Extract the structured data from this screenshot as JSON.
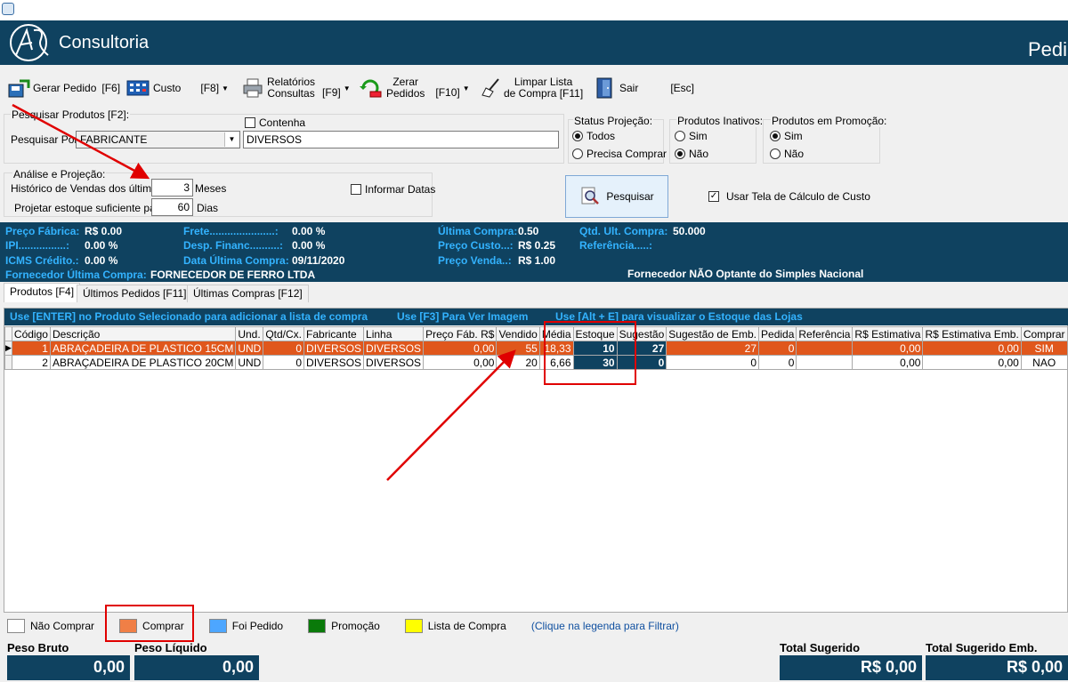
{
  "header": {
    "brand": "Consultoria",
    "title": "Pedi"
  },
  "toolbar": {
    "gerar_pedido": {
      "label": "Gerar Pedido",
      "key": "[F6]"
    },
    "custo": {
      "label": "Custo",
      "key": "[F8]"
    },
    "relatorios": {
      "label": "Relatórios\nConsultas",
      "key": "[F9]"
    },
    "zerar": {
      "label": "Zerar\nPedidos",
      "key": "[F10]"
    },
    "limpar": {
      "label": "Limpar Lista\nde Compra [F11]"
    },
    "sair": {
      "label": "Sair",
      "key": "[Esc]"
    }
  },
  "search": {
    "group_label": "Pesquisar Produtos [F2]:",
    "by_label": "Pesquisar Por:",
    "by_value": "FABRICANTE",
    "contains_label": "Contenha",
    "text_value": "DIVERSOS"
  },
  "status_projecao": {
    "label": "Status Projeção:",
    "options": [
      "Todos",
      "Precisa Comprar"
    ],
    "selected": "Todos"
  },
  "produtos_inativos": {
    "label": "Produtos Inativos:",
    "options": [
      "Sim",
      "Não"
    ],
    "selected": "Não"
  },
  "produtos_promocao": {
    "label": "Produtos em Promoção:",
    "options": [
      "Sim",
      "Não"
    ],
    "selected": "Sim"
  },
  "analise": {
    "group_label": "Análise e Projeção:",
    "historico_label": "Histórico de Vendas dos últimos",
    "historico_value": "3",
    "historico_unit": "Meses",
    "projetar_label": "Projetar estoque suficiente para",
    "projetar_value": "60",
    "projetar_unit": "Dias",
    "informar_datas": "Informar Datas"
  },
  "pesquisar_button": "Pesquisar",
  "usar_tela_calculo": "Usar Tela de Cálculo de Custo",
  "info": {
    "preco_fabrica_k": "Preço Fábrica:",
    "preco_fabrica_v": "R$ 0.00",
    "ipi_k": "IPI................:",
    "ipi_v": "0.00 %",
    "icms_k": "ICMS Crédito.:",
    "icms_v": "0.00 %",
    "fornecedor_ult_k": "Fornecedor Última Compra:",
    "fornecedor_ult_v": "FORNECEDOR DE FERRO LTDA",
    "frete_k": "Frete......................:",
    "frete_v": "0.00 %",
    "desp_financ_k": "Desp. Financ..........:",
    "desp_financ_v": "0.00 %",
    "data_ultima_k": "Data Última Compra:",
    "data_ultima_v": "09/11/2020",
    "ultima_compra_k": "Última Compra:",
    "ultima_compra_v": "0.50",
    "preco_custo_k": "Preço Custo...:",
    "preco_custo_v": "R$ 0.25",
    "preco_venda_k": "Preço Venda..:",
    "preco_venda_v": "R$ 1.00",
    "qtd_ult_compra_k": "Qtd. Ult. Compra:",
    "qtd_ult_compra_v": "50.000",
    "referencia_k": "Referência.....:",
    "simples_nacional": "Fornecedor NÃO Optante do Simples Nacional"
  },
  "tabs": [
    "Produtos [F4]",
    "Últimos Pedidos [F11]",
    "Últimas Compras [F12]"
  ],
  "hints": {
    "enter": "Use [ENTER] no Produto Selecionado para adicionar a lista de compra",
    "f3": "Use [F3] Para Ver Imagem",
    "alt_e": "Use [Alt + E] para visualizar o Estoque das Lojas"
  },
  "grid": {
    "columns": [
      "Código",
      "Descrição",
      "Und.",
      "Qtd/Cx.",
      "Fabricante",
      "Linha",
      "Preço Fáb. R$",
      "Vendido",
      "Média",
      "Estoque",
      "Sugestão",
      "Sugestão de Emb.",
      "Pedida",
      "Referência",
      "R$ Estimativa",
      "R$ Estimativa Emb.",
      "Comprar"
    ],
    "rows": [
      {
        "codigo": "1",
        "descricao": "ABRAÇADEIRA DE PLASTICO 15CM",
        "und": "UND",
        "qtd_cx": "0",
        "fabricante": "DIVERSOS",
        "linha": "DIVERSOS",
        "preco_fab": "0,00",
        "vendido": "55",
        "media": "18,33",
        "estoque": "10",
        "sugestao": "27",
        "sugestao_emb": "27",
        "pedida": "0",
        "referencia": "",
        "estimativa": "0,00",
        "estimativa_emb": "0,00",
        "comprar": "SIM"
      },
      {
        "codigo": "2",
        "descricao": "ABRAÇADEIRA DE PLASTICO 20CM",
        "und": "UND",
        "qtd_cx": "0",
        "fabricante": "DIVERSOS",
        "linha": "DIVERSOS",
        "preco_fab": "0,00",
        "vendido": "20",
        "media": "6,66",
        "estoque": "30",
        "sugestao": "0",
        "sugestao_emb": "0",
        "pedida": "0",
        "referencia": "",
        "estimativa": "0,00",
        "estimativa_emb": "0,00",
        "comprar": "NAO"
      }
    ]
  },
  "legend": {
    "items": [
      {
        "label": "Não Comprar",
        "color": "#ffffff"
      },
      {
        "label": "Comprar",
        "color": "#f07f46"
      },
      {
        "label": "Foi Pedido",
        "color": "#4da6ff"
      },
      {
        "label": "Promoção",
        "color": "#0a7a0a"
      },
      {
        "label": "Lista de Compra",
        "color": "#ffff00"
      }
    ],
    "hint": "(Clique na legenda para Filtrar)"
  },
  "footer": {
    "peso_bruto_label": "Peso Bruto",
    "peso_bruto_value": "0,00",
    "peso_liquido_label": "Peso Líquido",
    "peso_liquido_value": "0,00",
    "total_sugerido_label": "Total Sugerido",
    "total_sugerido_value": "R$ 0,00",
    "total_sugerido_emb_label": "Total Sugerido Emb.",
    "total_sugerido_emb_value": "R$ 0,00"
  },
  "colors": {
    "header_bg": "#0f4260",
    "highlight_row": "#e0571c",
    "info_key": "#33b3ff",
    "annotation": "#e00000"
  }
}
